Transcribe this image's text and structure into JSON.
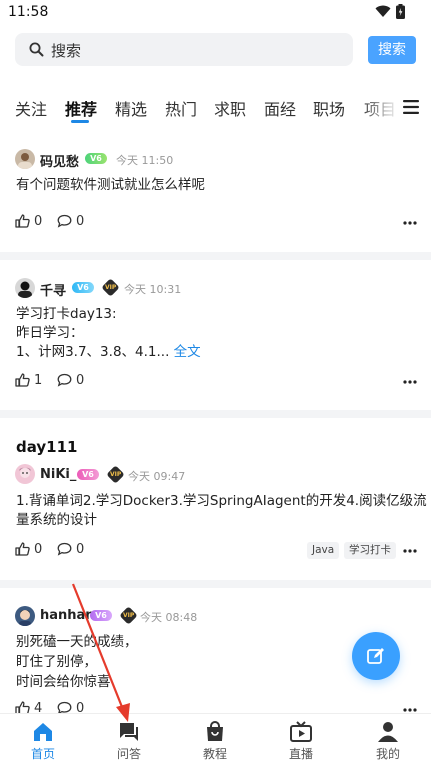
{
  "status_bar": {
    "time": "11:58"
  },
  "search": {
    "placeholder": "搜索",
    "button": "搜索"
  },
  "tabs": [
    "关注",
    "推荐",
    "精选",
    "热门",
    "求职",
    "面经",
    "职场",
    "项目"
  ],
  "active_tab": "推荐",
  "posts": [
    {
      "user": "码见愁",
      "level": "V6",
      "time": "今天 11:50",
      "text": "有个问题软件测试就业怎么样呢",
      "likes": "0",
      "comments": "0"
    },
    {
      "user": "千寻",
      "level": "V6",
      "vip": "VIP",
      "time": "今天 10:31",
      "text_lines": [
        "学习打卡day13:",
        "昨日学习：",
        "1、计网3.7、3.8、4.1... "
      ],
      "more": "全文",
      "likes": "1",
      "comments": "0"
    },
    {
      "title": "day111",
      "user": "NiKi_",
      "level": "V6",
      "vip": "VIP",
      "time": "今天 09:47",
      "text_lines": [
        "1.背诵单词2.学习Docker3.学习SpringAIagent的开发4.阅读亿级流",
        "量系统的设计"
      ],
      "likes": "0",
      "comments": "0",
      "tags": [
        "Java",
        "学习打卡"
      ]
    },
    {
      "user": "hanhan",
      "level": "V6",
      "vip": "VIP",
      "time": "今天 08:48",
      "text_lines": [
        "别死磕一天的成绩，",
        "盯住了别停，",
        "时间会给你惊喜"
      ],
      "likes": "4",
      "comments": "0"
    }
  ],
  "bottom_nav": [
    {
      "label": "首页",
      "icon": "home-icon"
    },
    {
      "label": "问答",
      "icon": "chat-icon"
    },
    {
      "label": "教程",
      "icon": "bag-icon"
    },
    {
      "label": "直播",
      "icon": "tv-icon"
    },
    {
      "label": "我的",
      "icon": "person-icon"
    }
  ],
  "colors": {
    "accent": "#1e88e5",
    "search_button": "#4aa3ff",
    "annotation": "#e53b2c"
  }
}
